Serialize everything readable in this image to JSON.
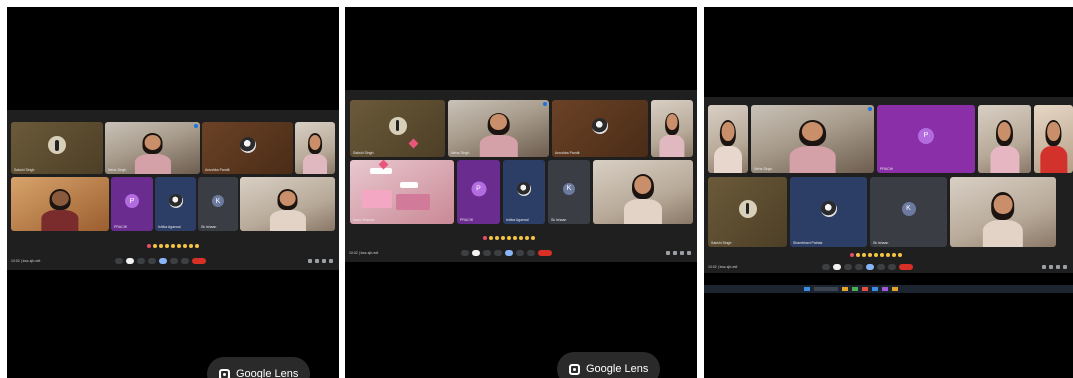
{
  "lens_label": "Google Lens",
  "panels": [
    {
      "meeting_time": "10:02 | kwz-sjb-edt",
      "tiles": [
        {
          "name": "Sakshi Singh",
          "kind": "lamp"
        },
        {
          "name": "Neha Singh",
          "kind": "video"
        },
        {
          "name": "Anushka Pandit",
          "kind": "photo"
        },
        {
          "name": "",
          "kind": "video"
        },
        {
          "name": "",
          "kind": "video"
        },
        {
          "name": "PRACHI",
          "kind": "avatar",
          "letter": "P"
        },
        {
          "name": "Ishika Agarwal",
          "kind": "photo"
        },
        {
          "name": "Sk ishaan",
          "kind": "avatar",
          "letter": "K"
        },
        {
          "name": "",
          "kind": "video"
        }
      ]
    },
    {
      "meeting_time": "10:02 | kwz-sjb-edt",
      "tiles": [
        {
          "name": "Sakshi Singh",
          "kind": "lamp"
        },
        {
          "name": "Neha Singh",
          "kind": "video"
        },
        {
          "name": "Anushka Pandit",
          "kind": "photo"
        },
        {
          "name": "",
          "kind": "video"
        },
        {
          "name": "Annu Sharma",
          "kind": "stickers"
        },
        {
          "name": "PRACHI",
          "kind": "avatar",
          "letter": "P"
        },
        {
          "name": "Ishika Agarwal",
          "kind": "photo"
        },
        {
          "name": "Sk ishaan",
          "kind": "avatar",
          "letter": "K"
        },
        {
          "name": "",
          "kind": "video"
        }
      ]
    },
    {
      "meeting_time": "10:02 | kwz-sjb-edt",
      "tiles": [
        {
          "name": "",
          "kind": "video"
        },
        {
          "name": "Neha Singh",
          "kind": "video"
        },
        {
          "name": "PRACHI",
          "kind": "avatar",
          "letter": "P"
        },
        {
          "name": "",
          "kind": "video"
        },
        {
          "name": "",
          "kind": "video"
        },
        {
          "name": "Sakshi Singh",
          "kind": "lamp"
        },
        {
          "name": "Shambhavi Pathak",
          "kind": "photo"
        },
        {
          "name": "Sk ishaan",
          "kind": "avatar",
          "letter": "K"
        },
        {
          "name": "",
          "kind": "video"
        }
      ]
    }
  ]
}
